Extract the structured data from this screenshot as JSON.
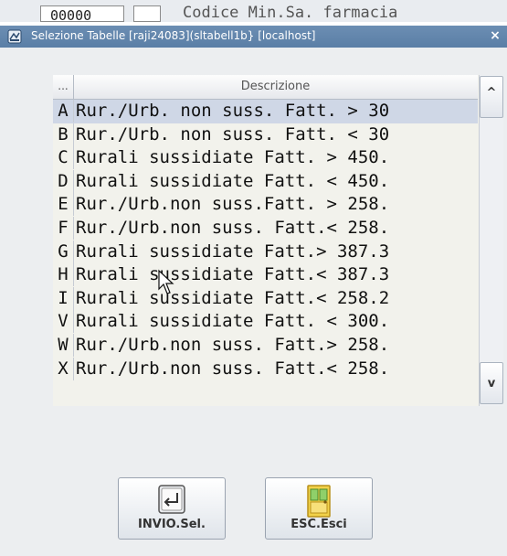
{
  "background_window": {
    "field_value": "00000",
    "title_text": "Codice Min.Sa. farmacia"
  },
  "dialog": {
    "title": "Selezione Tabelle [raji24083](sltabell1b} [localhost]",
    "close_glyph": "×",
    "table": {
      "header_col1": "...",
      "header_col2": "Descrizione",
      "selected_row_index": 0,
      "rows": [
        {
          "code": "A",
          "desc": "Rur./Urb. non suss. Fatt. > 30"
        },
        {
          "code": "B",
          "desc": "Rur./Urb. non suss. Fatt. < 30"
        },
        {
          "code": "C",
          "desc": "Rurali sussidiate Fatt. > 450."
        },
        {
          "code": "D",
          "desc": "Rurali sussidiate Fatt. < 450."
        },
        {
          "code": "E",
          "desc": "Rur./Urb.non suss.Fatt. > 258."
        },
        {
          "code": "F",
          "desc": "Rur./Urb.non suss. Fatt.< 258."
        },
        {
          "code": "G",
          "desc": "Rurali sussidiate Fatt.> 387.3"
        },
        {
          "code": "H",
          "desc": "Rurali sussidiate Fatt.< 387.3"
        },
        {
          "code": "I",
          "desc": "Rurali sussidiate Fatt.< 258.2"
        },
        {
          "code": "V",
          "desc": "Rurali sussidiate Fatt. < 300."
        },
        {
          "code": "W",
          "desc": "Rur./Urb.non suss. Fatt.> 258."
        },
        {
          "code": "X",
          "desc": "Rur./Urb.non suss. Fatt.< 258."
        }
      ],
      "scroll_up_glyph": "^",
      "scroll_down_glyph": "v"
    },
    "buttons": {
      "invio_label": "INVIO.Sel.",
      "esc_label": "ESC.Esci"
    }
  },
  "colors": {
    "titlebar": "#5a7ea6",
    "selected_row": "#cfd7e6",
    "table_bg": "#f2f2ec"
  }
}
